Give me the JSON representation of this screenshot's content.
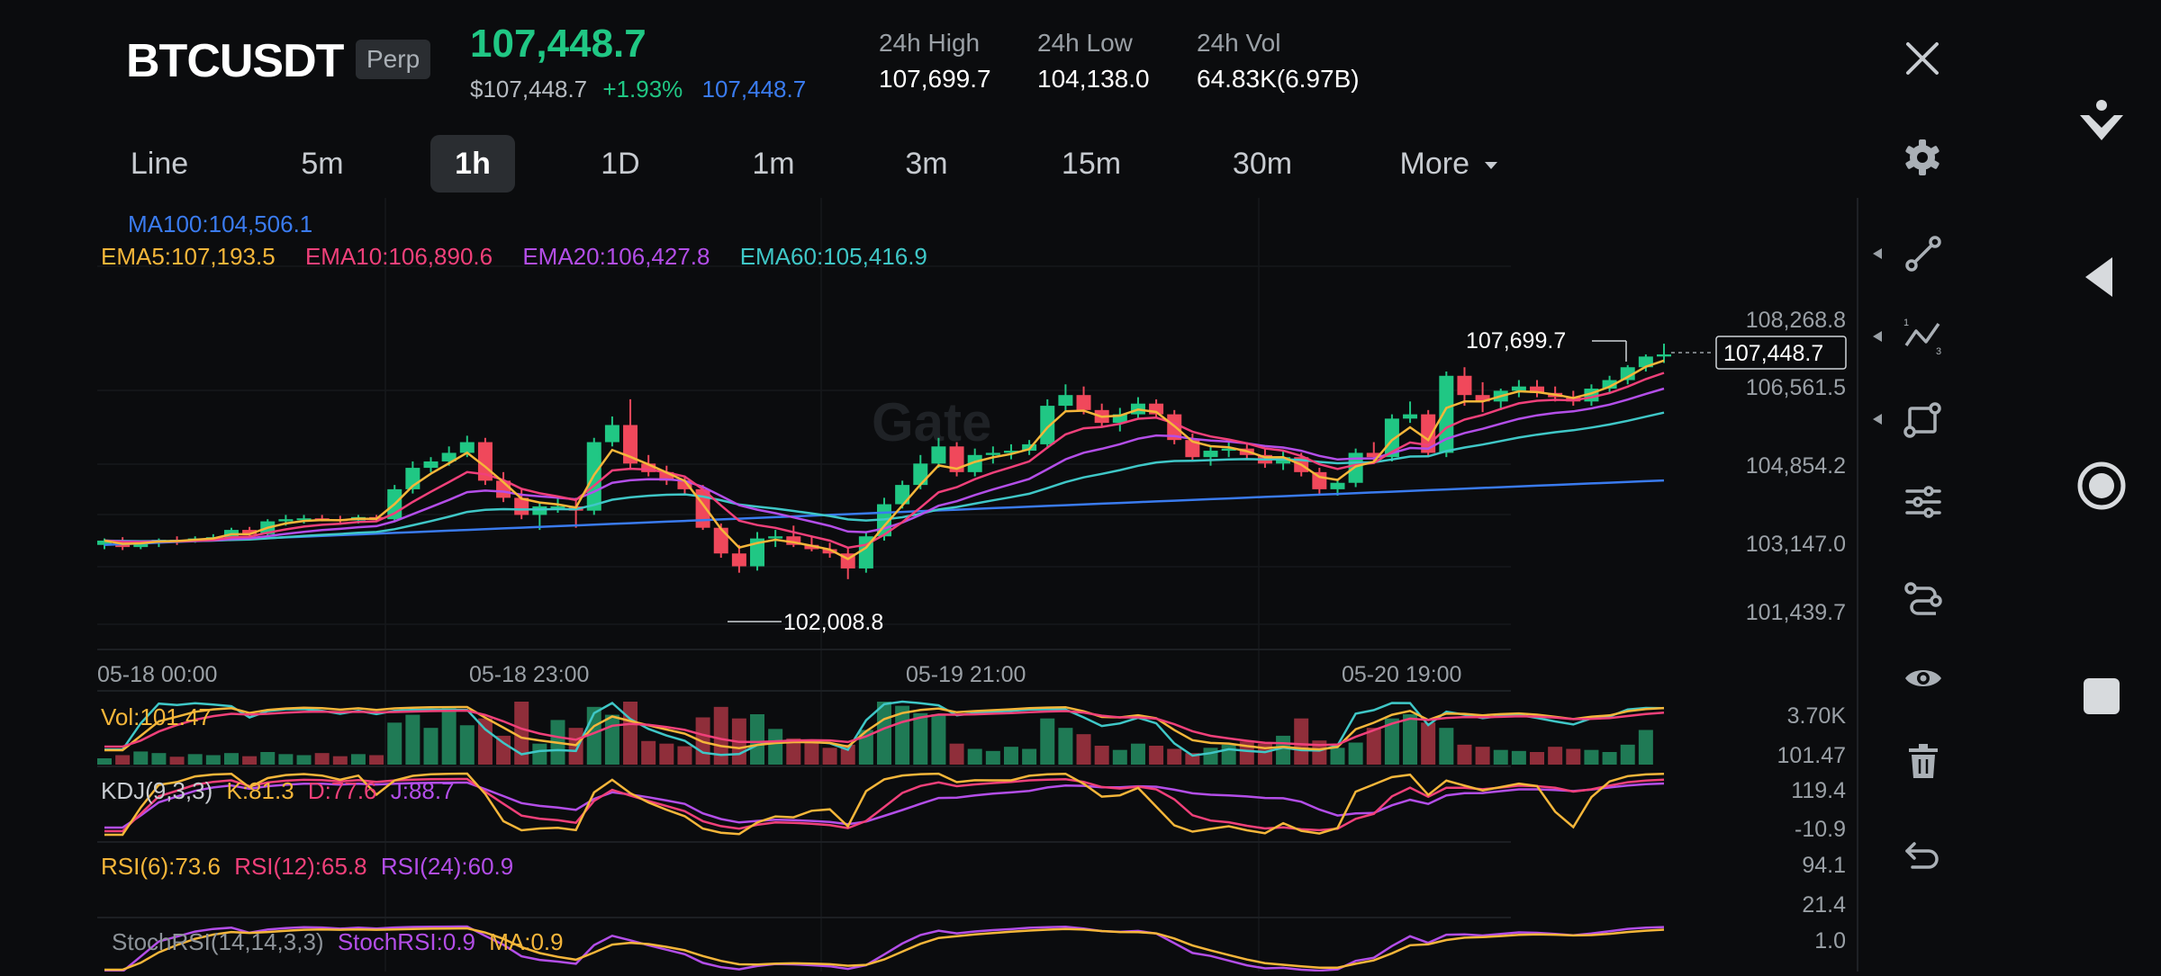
{
  "header": {
    "symbol": "BTCUSDT",
    "contract_type": "Perp",
    "last_price": "107,448.7",
    "usd_price": "$107,448.7",
    "change_pct": "+1.93%",
    "mark_price": "107,448.7",
    "stats": [
      {
        "label": "24h High",
        "value": "107,699.7"
      },
      {
        "label": "24h Low",
        "value": "104,138.0"
      },
      {
        "label": "24h Vol",
        "value": "64.83K(6.97B)"
      }
    ]
  },
  "intervals": [
    "Line",
    "5m",
    "1h",
    "1D",
    "1m",
    "3m",
    "15m",
    "30m",
    "More"
  ],
  "selected_interval": "1h",
  "watermark": "Gate",
  "indicators": {
    "ma100": "MA100:104,506.1",
    "ema5": "EMA5:107,193.5",
    "ema10": "EMA10:106,890.6",
    "ema20": "EMA20:106,427.8",
    "ema60": "EMA60:105,416.9",
    "vol": "Vol:101.47",
    "kdj": "KDJ(9,3,3)",
    "kdj_k": "K:81.3",
    "kdj_d": "D:77.6",
    "kdj_j": "J:88.7",
    "rsi6": "RSI(6):73.6",
    "rsi12": "RSI(12):65.8",
    "rsi24": "RSI(24):60.9",
    "stoch": "StochRSI(14,14,3,3)",
    "stoch_val": "StochRSI:0.9",
    "stoch_ma": "MA:0.9"
  },
  "annotations": {
    "high_label": "107,699.7",
    "low_label": "102,008.8",
    "current_price_tag": "107,448.7"
  },
  "colors": {
    "up": "#20c784",
    "down": "#f0485b",
    "ma100": "#3a7bef",
    "ema5": "#f5b63a",
    "ema10": "#f0407a",
    "ema20": "#b34ee8",
    "ema60": "#3fc7c7"
  },
  "chart_data": {
    "type": "candlestick",
    "y_ticks": [
      "108,268.8",
      "106,561.5",
      "104,854.2",
      "103,147.0",
      "101,439.7"
    ],
    "ylim": [
      101439.7,
      108268.8
    ],
    "x_ticks": [
      "05-18 00:00",
      "05-18 23:00",
      "05-19 21:00",
      "05-20 19:00"
    ],
    "vol_ticks": [
      "3.70K",
      "101.47"
    ],
    "kdj_ticks": [
      "119.4",
      "-10.9"
    ],
    "rsi_ticks": [
      "94.1",
      "21.4"
    ],
    "stoch_ticks": [
      "1.0"
    ],
    "ohlc": [
      [
        103000,
        103150,
        102900,
        103100
      ],
      [
        103100,
        103180,
        102880,
        102950
      ],
      [
        102950,
        103100,
        102900,
        103050
      ],
      [
        103050,
        103150,
        102950,
        103120
      ],
      [
        103120,
        103200,
        103000,
        103100
      ],
      [
        103100,
        103200,
        103050,
        103150
      ],
      [
        103150,
        103250,
        103080,
        103180
      ],
      [
        103180,
        103400,
        103100,
        103350
      ],
      [
        103350,
        103420,
        103200,
        103250
      ],
      [
        103250,
        103600,
        103200,
        103550
      ],
      [
        103550,
        103700,
        103450,
        103600
      ],
      [
        103600,
        103700,
        103500,
        103620
      ],
      [
        103620,
        103700,
        103550,
        103600
      ],
      [
        103600,
        103680,
        103520,
        103570
      ],
      [
        103570,
        103700,
        103500,
        103650
      ],
      [
        103650,
        103700,
        103550,
        103600
      ],
      [
        103600,
        104400,
        103550,
        104300
      ],
      [
        104300,
        104950,
        104200,
        104800
      ],
      [
        104800,
        105050,
        104700,
        104950
      ],
      [
        104950,
        105300,
        104850,
        105150
      ],
      [
        105150,
        105550,
        105050,
        105400
      ],
      [
        105400,
        105500,
        104400,
        104500
      ],
      [
        104500,
        104700,
        104000,
        104100
      ],
      [
        104100,
        104300,
        103600,
        103700
      ],
      [
        103700,
        104000,
        103350,
        103900
      ],
      [
        103900,
        104150,
        103750,
        103900
      ],
      [
        103900,
        104100,
        103400,
        103800
      ],
      [
        103800,
        105500,
        103700,
        105400
      ],
      [
        105400,
        106000,
        105300,
        105800
      ],
      [
        105800,
        106400,
        104800,
        104900
      ],
      [
        104900,
        105100,
        104600,
        104700
      ],
      [
        104700,
        104850,
        104400,
        104500
      ],
      [
        104500,
        104600,
        104150,
        104300
      ],
      [
        104300,
        104400,
        103350,
        103400
      ],
      [
        103400,
        103500,
        102700,
        102800
      ],
      [
        102800,
        103000,
        102350,
        102500
      ],
      [
        102500,
        103300,
        102400,
        103150
      ],
      [
        103150,
        103350,
        102950,
        103200
      ],
      [
        103200,
        103450,
        102950,
        103000
      ],
      [
        103000,
        103200,
        102850,
        102900
      ],
      [
        102900,
        103050,
        102700,
        102800
      ],
      [
        102800,
        102950,
        102200,
        102450
      ],
      [
        102450,
        103300,
        102350,
        103200
      ],
      [
        103200,
        104100,
        103100,
        103950
      ],
      [
        103950,
        104500,
        103850,
        104400
      ],
      [
        104400,
        105100,
        104300,
        104900
      ],
      [
        104900,
        105500,
        104800,
        105300
      ],
      [
        105300,
        105400,
        104600,
        104700
      ],
      [
        104700,
        105250,
        104600,
        105100
      ],
      [
        105100,
        105300,
        104900,
        105150
      ],
      [
        105150,
        105350,
        105000,
        105200
      ],
      [
        105200,
        105450,
        105100,
        105350
      ],
      [
        105350,
        106400,
        105250,
        106250
      ],
      [
        106250,
        106750,
        106100,
        106500
      ],
      [
        106500,
        106700,
        106050,
        106150
      ],
      [
        106150,
        106300,
        105750,
        105850
      ],
      [
        105850,
        106200,
        105650,
        106050
      ],
      [
        106050,
        106450,
        105950,
        106300
      ],
      [
        106300,
        106400,
        105950,
        106050
      ],
      [
        106050,
        106150,
        105350,
        105450
      ],
      [
        105450,
        105600,
        104950,
        105050
      ],
      [
        105050,
        105300,
        104850,
        105200
      ],
      [
        105200,
        105400,
        105050,
        105250
      ],
      [
        105250,
        105350,
        105000,
        105100
      ],
      [
        105100,
        105250,
        104800,
        104900
      ],
      [
        104900,
        105200,
        104750,
        105050
      ],
      [
        105050,
        105150,
        104600,
        104700
      ],
      [
        104700,
        104800,
        104150,
        104300
      ],
      [
        104300,
        104550,
        104150,
        104450
      ],
      [
        104450,
        105250,
        104350,
        105150
      ],
      [
        105150,
        105400,
        104950,
        105050
      ],
      [
        105050,
        106050,
        104950,
        105950
      ],
      [
        105950,
        106350,
        105850,
        106050
      ],
      [
        106050,
        106150,
        105050,
        105150
      ],
      [
        105150,
        107050,
        105050,
        106950
      ],
      [
        106950,
        107150,
        106250,
        106500
      ],
      [
        106500,
        106800,
        106100,
        106350
      ],
      [
        106350,
        106650,
        106150,
        106600
      ],
      [
        106600,
        106850,
        106450,
        106700
      ],
      [
        106700,
        106850,
        106450,
        106550
      ],
      [
        106550,
        106700,
        106350,
        106450
      ],
      [
        106450,
        106600,
        106250,
        106350
      ],
      [
        106350,
        106750,
        106250,
        106650
      ],
      [
        106650,
        106950,
        106550,
        106850
      ],
      [
        106850,
        107200,
        106750,
        107150
      ],
      [
        107150,
        107450,
        107050,
        107400
      ],
      [
        107400,
        107700,
        107250,
        107450
      ]
    ],
    "volume": [
      12,
      18,
      25,
      22,
      15,
      20,
      18,
      22,
      16,
      24,
      20,
      18,
      22,
      16,
      20,
      18,
      80,
      95,
      70,
      110,
      75,
      88,
      55,
      120,
      40,
      85,
      70,
      110,
      95,
      120,
      45,
      40,
      35,
      90,
      110,
      88,
      96,
      68,
      50,
      42,
      32,
      38,
      66,
      120,
      112,
      98,
      96,
      40,
      30,
      26,
      34,
      30,
      88,
      70,
      58,
      36,
      28,
      40,
      36,
      30,
      22,
      32,
      38,
      44,
      40,
      55,
      88,
      46,
      32,
      42,
      70,
      88,
      96,
      80,
      70,
      38,
      34,
      28,
      26,
      24,
      34,
      30,
      28,
      24,
      38,
      66
    ]
  }
}
